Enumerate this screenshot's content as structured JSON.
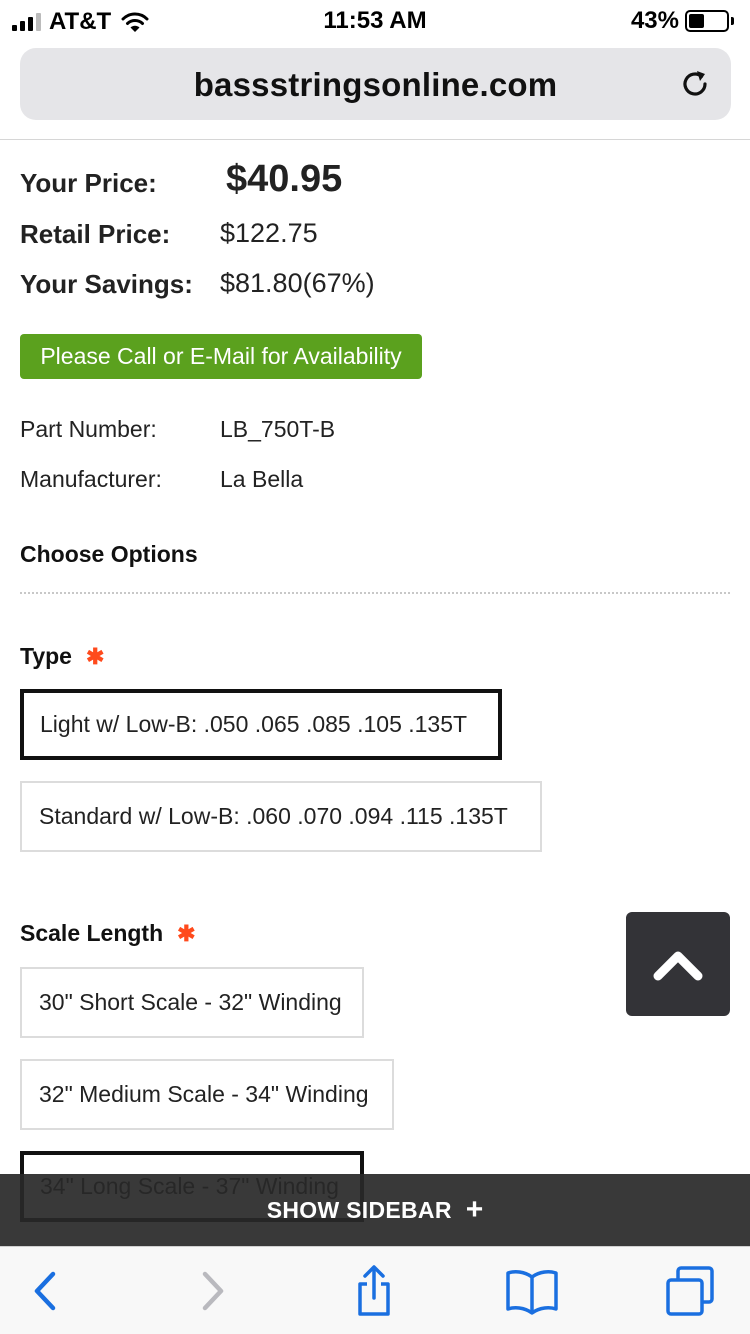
{
  "status": {
    "carrier": "AT&T",
    "time": "11:53 AM",
    "battery_pct": "43%",
    "battery_level": 0.43
  },
  "browser": {
    "url": "bassstringsonline.com"
  },
  "pricing": {
    "your_price_label": "Your Price:",
    "your_price": "$40.95",
    "retail_label": "Retail Price:",
    "retail": "$122.75",
    "savings_label": "Your Savings:",
    "savings": "$81.80(67%)"
  },
  "availability_button": "Please Call or E-Mail for Availability",
  "details": {
    "part_label": "Part Number:",
    "part": "LB_750T-B",
    "manufacturer_label": "Manufacturer:",
    "manufacturer": "La Bella"
  },
  "choose_options": "Choose Options",
  "type_group": {
    "title": "Type",
    "required_mark": "✱",
    "options": [
      "Light w/ Low-B: .050 .065 .085 .105 .135T",
      "Standard w/ Low-B: .060 .070 .094 .115 .135T"
    ],
    "selected_index": 0
  },
  "scale_group": {
    "title": "Scale Length",
    "required_mark": "✱",
    "options": [
      "30\" Short Scale - 32\" Winding",
      "32\" Medium Scale - 34\" Winding",
      "34\" Long Scale - 37\" Winding"
    ],
    "selected_index": 2
  },
  "sidebar_toggle": {
    "label": "SHOW SIDEBAR",
    "icon": "+"
  },
  "colors": {
    "accent_green": "#5ba11e",
    "ios_blue": "#1a6fe0",
    "required_red": "#ff4a1c"
  }
}
